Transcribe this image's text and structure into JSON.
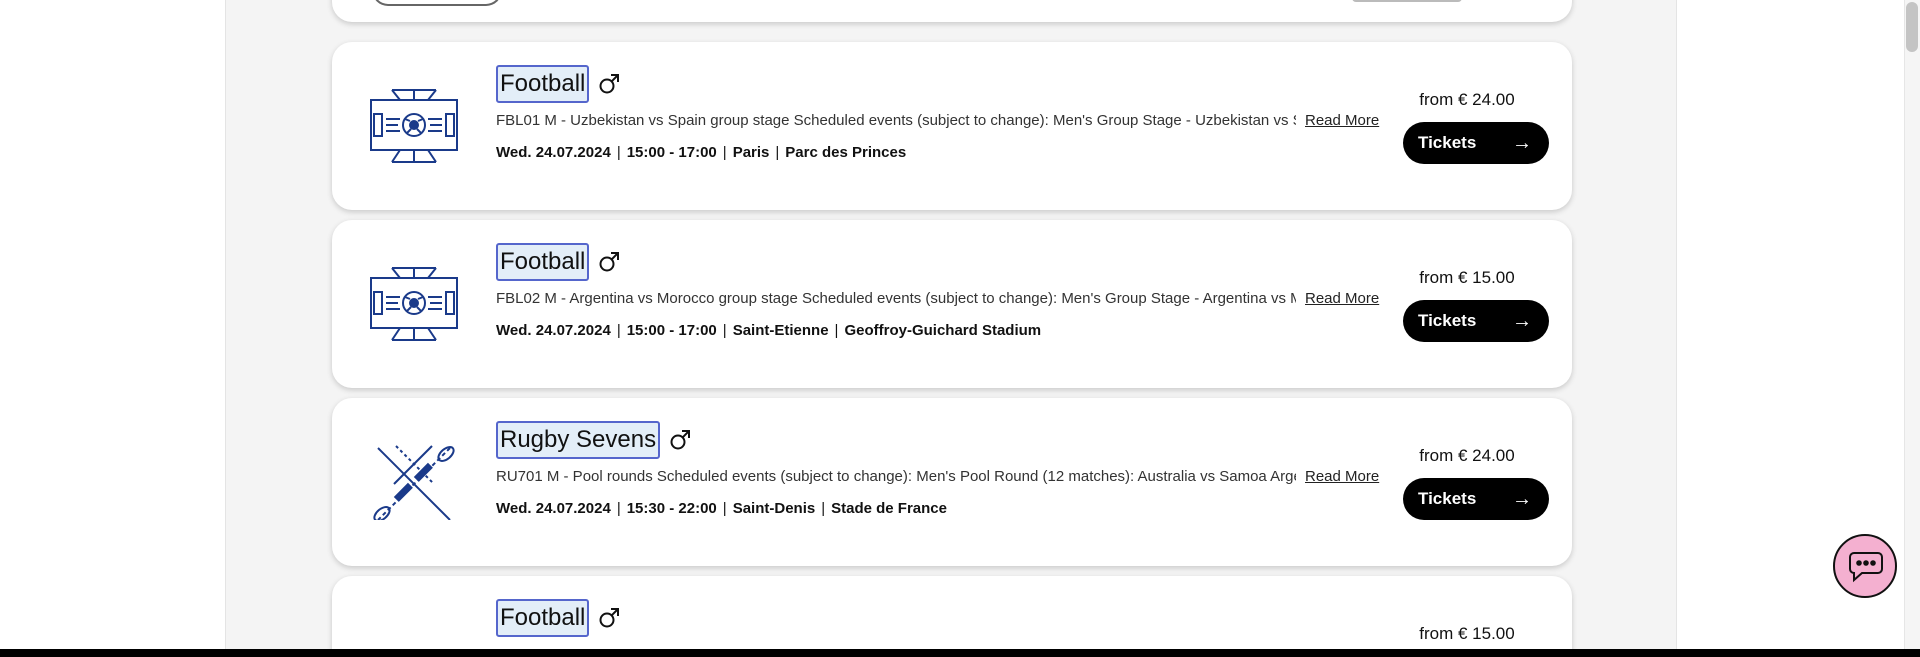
{
  "events": [
    {
      "sport": "Football",
      "icon": "football-pitch-icon",
      "gender_icon": "male-symbol-icon",
      "description": "FBL01 M - Uzbekistan vs Spain group stage Scheduled events (subject to change): Men's Group Stage - Uzbekistan vs Spai",
      "read_more": "Read More",
      "date": "Wed. 24.07.2024",
      "time": "15:00 - 17:00",
      "city": "Paris",
      "venue": "Parc des Princes",
      "price": "from € 24.00",
      "tickets_label": "Tickets",
      "separator": "|"
    },
    {
      "sport": "Football",
      "icon": "football-pitch-icon",
      "gender_icon": "male-symbol-icon",
      "description": "FBL02 M - Argentina vs Morocco group stage Scheduled events (subject to change): Men's Group Stage - Argentina vs Morc",
      "read_more": "Read More",
      "date": "Wed. 24.07.2024",
      "time": "15:00 - 17:00",
      "city": "Saint-Etienne",
      "venue": "Geoffroy-Guichard Stadium",
      "price": "from € 15.00",
      "tickets_label": "Tickets",
      "separator": "|"
    },
    {
      "sport": "Rugby Sevens",
      "icon": "rugby-balls-icon",
      "gender_icon": "male-symbol-icon",
      "description": "RU701 M - Pool rounds Scheduled events (subject to change): Men's Pool Round (12 matches): Australia vs Samoa Argenti",
      "read_more": "Read More",
      "date": "Wed. 24.07.2024",
      "time": "15:30 - 22:00",
      "city": "Saint-Denis",
      "venue": "Stade de France",
      "price": "from € 24.00",
      "tickets_label": "Tickets",
      "separator": "|"
    },
    {
      "sport": "Football",
      "icon": "football-pitch-icon",
      "gender_icon": "male-symbol-icon",
      "price": "from € 15.00"
    }
  ],
  "chat": {
    "icon": "chat-bubble-icon"
  },
  "colors": {
    "icon_navy": "#1a3a8a",
    "title_highlight_bg": "#e3eef8",
    "title_highlight_border": "#5566cc",
    "button_bg": "#000000",
    "chat_bg": "#f4b0d0"
  }
}
